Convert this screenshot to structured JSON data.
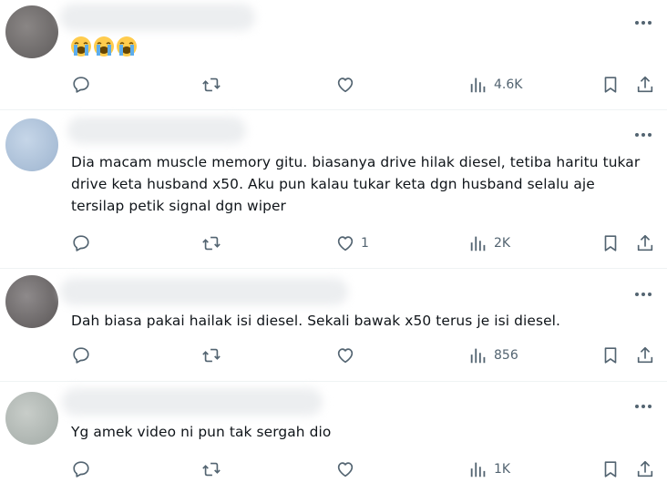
{
  "tweets": [
    {
      "text": "",
      "has_emoji": true,
      "emojis": [
        "loudly-crying-face",
        "loudly-crying-face",
        "loudly-crying-face"
      ],
      "likes": "",
      "views": "4.6K"
    },
    {
      "text": "Dia macam muscle memory gitu. biasanya drive hilak diesel,  tetiba haritu tukar drive keta husband x50. Aku pun kalau tukar keta dgn husband selalu aje tersilap petik signal dgn wiper",
      "likes": "1",
      "views": "2K"
    },
    {
      "text": "Dah biasa pakai hailak isi diesel. Sekali bawak x50 terus je isi diesel.",
      "likes": "",
      "views": "856"
    },
    {
      "text": "Yg amek video ni pun tak sergah dio",
      "likes": "",
      "views": "1K"
    }
  ],
  "colors": {
    "icon": "#536471",
    "separator": "#eff3f4",
    "text": "#0f1419"
  }
}
